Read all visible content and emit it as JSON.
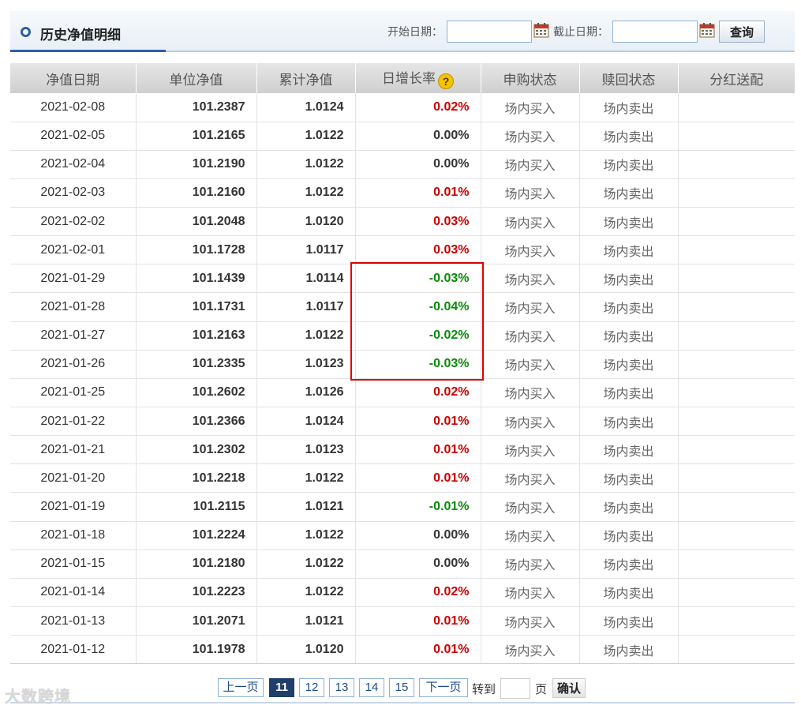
{
  "header": {
    "title": "历史净值明细",
    "start_label": "开始日期：",
    "end_label": "截止日期：",
    "start_value": "",
    "end_value": "",
    "query_label": "查询"
  },
  "table": {
    "columns": [
      "净值日期",
      "单位净值",
      "累计净值",
      "日增长率",
      "申购状态",
      "赎回状态",
      "分红送配"
    ],
    "rows": [
      {
        "date": "2021-02-08",
        "unit": "101.2387",
        "acc": "1.0124",
        "rate": "0.02%",
        "trend": "up",
        "buy": "场内买入",
        "sell": "场内卖出",
        "div": ""
      },
      {
        "date": "2021-02-05",
        "unit": "101.2165",
        "acc": "1.0122",
        "rate": "0.00%",
        "trend": "flat",
        "buy": "场内买入",
        "sell": "场内卖出",
        "div": ""
      },
      {
        "date": "2021-02-04",
        "unit": "101.2190",
        "acc": "1.0122",
        "rate": "0.00%",
        "trend": "flat",
        "buy": "场内买入",
        "sell": "场内卖出",
        "div": ""
      },
      {
        "date": "2021-02-03",
        "unit": "101.2160",
        "acc": "1.0122",
        "rate": "0.01%",
        "trend": "up",
        "buy": "场内买入",
        "sell": "场内卖出",
        "div": ""
      },
      {
        "date": "2021-02-02",
        "unit": "101.2048",
        "acc": "1.0120",
        "rate": "0.03%",
        "trend": "up",
        "buy": "场内买入",
        "sell": "场内卖出",
        "div": ""
      },
      {
        "date": "2021-02-01",
        "unit": "101.1728",
        "acc": "1.0117",
        "rate": "0.03%",
        "trend": "up",
        "buy": "场内买入",
        "sell": "场内卖出",
        "div": ""
      },
      {
        "date": "2021-01-29",
        "unit": "101.1439",
        "acc": "1.0114",
        "rate": "-0.03%",
        "trend": "down",
        "buy": "场内买入",
        "sell": "场内卖出",
        "div": ""
      },
      {
        "date": "2021-01-28",
        "unit": "101.1731",
        "acc": "1.0117",
        "rate": "-0.04%",
        "trend": "down",
        "buy": "场内买入",
        "sell": "场内卖出",
        "div": ""
      },
      {
        "date": "2021-01-27",
        "unit": "101.2163",
        "acc": "1.0122",
        "rate": "-0.02%",
        "trend": "down",
        "buy": "场内买入",
        "sell": "场内卖出",
        "div": ""
      },
      {
        "date": "2021-01-26",
        "unit": "101.2335",
        "acc": "1.0123",
        "rate": "-0.03%",
        "trend": "down",
        "buy": "场内买入",
        "sell": "场内卖出",
        "div": ""
      },
      {
        "date": "2021-01-25",
        "unit": "101.2602",
        "acc": "1.0126",
        "rate": "0.02%",
        "trend": "up",
        "buy": "场内买入",
        "sell": "场内卖出",
        "div": ""
      },
      {
        "date": "2021-01-22",
        "unit": "101.2366",
        "acc": "1.0124",
        "rate": "0.01%",
        "trend": "up",
        "buy": "场内买入",
        "sell": "场内卖出",
        "div": ""
      },
      {
        "date": "2021-01-21",
        "unit": "101.2302",
        "acc": "1.0123",
        "rate": "0.01%",
        "trend": "up",
        "buy": "场内买入",
        "sell": "场内卖出",
        "div": ""
      },
      {
        "date": "2021-01-20",
        "unit": "101.2218",
        "acc": "1.0122",
        "rate": "0.01%",
        "trend": "up",
        "buy": "场内买入",
        "sell": "场内卖出",
        "div": ""
      },
      {
        "date": "2021-01-19",
        "unit": "101.2115",
        "acc": "1.0121",
        "rate": "-0.01%",
        "trend": "down",
        "buy": "场内买入",
        "sell": "场内卖出",
        "div": ""
      },
      {
        "date": "2021-01-18",
        "unit": "101.2224",
        "acc": "1.0122",
        "rate": "0.00%",
        "trend": "flat",
        "buy": "场内买入",
        "sell": "场内卖出",
        "div": ""
      },
      {
        "date": "2021-01-15",
        "unit": "101.2180",
        "acc": "1.0122",
        "rate": "0.00%",
        "trend": "flat",
        "buy": "场内买入",
        "sell": "场内卖出",
        "div": ""
      },
      {
        "date": "2021-01-14",
        "unit": "101.2223",
        "acc": "1.0122",
        "rate": "0.02%",
        "trend": "up",
        "buy": "场内买入",
        "sell": "场内卖出",
        "div": ""
      },
      {
        "date": "2021-01-13",
        "unit": "101.2071",
        "acc": "1.0121",
        "rate": "0.01%",
        "trend": "up",
        "buy": "场内买入",
        "sell": "场内卖出",
        "div": ""
      },
      {
        "date": "2021-01-12",
        "unit": "101.1978",
        "acc": "1.0120",
        "rate": "0.01%",
        "trend": "up",
        "buy": "场内买入",
        "sell": "场内卖出",
        "div": ""
      }
    ]
  },
  "colors": {
    "up": "#cc0000",
    "down": "#0b8a0b",
    "highlight_box": "#e00000",
    "accent": "#2a5ea8"
  },
  "icons": {
    "help": "question-mark-icon",
    "calendar": "calendar-icon"
  },
  "help_glyph": "?",
  "pager": {
    "prev": "上一页",
    "pages": [
      "11",
      "12",
      "13",
      "14",
      "15"
    ],
    "current": "11",
    "next": "下一页",
    "goto_label": "转到",
    "page_unit": "页",
    "confirm": "确认",
    "goto_value": ""
  },
  "watermark": "大数跨境"
}
